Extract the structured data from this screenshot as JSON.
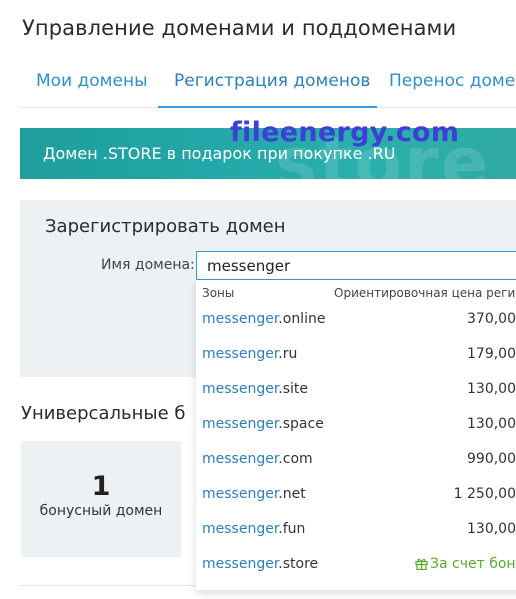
{
  "page": {
    "title": "Управление доменами и поддоменами"
  },
  "tabs": [
    {
      "label": "Мои домены",
      "active": false
    },
    {
      "label": "Регистрация доменов",
      "active": true
    },
    {
      "label": "Перенос доме",
      "active": false
    }
  ],
  "banner": {
    "text": "Домен .STORE в подарок при покупке .RU",
    "background_word": "store",
    "color": "#24a7a8"
  },
  "watermark": {
    "text": "fileenergy.com"
  },
  "register": {
    "title": "Зарегистрировать домен",
    "domain_label": "Имя домена:",
    "domain_value": "messenger"
  },
  "suggestions": {
    "header_zone": "Зоны",
    "header_price": "Ориентировочная цена регист",
    "items": [
      {
        "name": "messenger",
        "zone": ".online",
        "price": "370,00"
      },
      {
        "name": "messenger",
        "zone": ".ru",
        "price": "179,00"
      },
      {
        "name": "messenger",
        "zone": ".site",
        "price": "130,00"
      },
      {
        "name": "messenger",
        "zone": ".space",
        "price": "130,00"
      },
      {
        "name": "messenger",
        "zone": ".com",
        "price": "990,00"
      },
      {
        "name": "messenger",
        "zone": ".net",
        "price": "1 250,00"
      },
      {
        "name": "messenger",
        "zone": ".fun",
        "price": "130,00"
      }
    ],
    "bonus_item": {
      "name": "messenger",
      "zone": ".store",
      "bonus_text": "За счет бону",
      "icon": "gift-icon",
      "color": "#5aa830"
    }
  },
  "universal": {
    "title": "Универсальные б",
    "bonus_count": "1",
    "bonus_label": "бонусный домен"
  }
}
